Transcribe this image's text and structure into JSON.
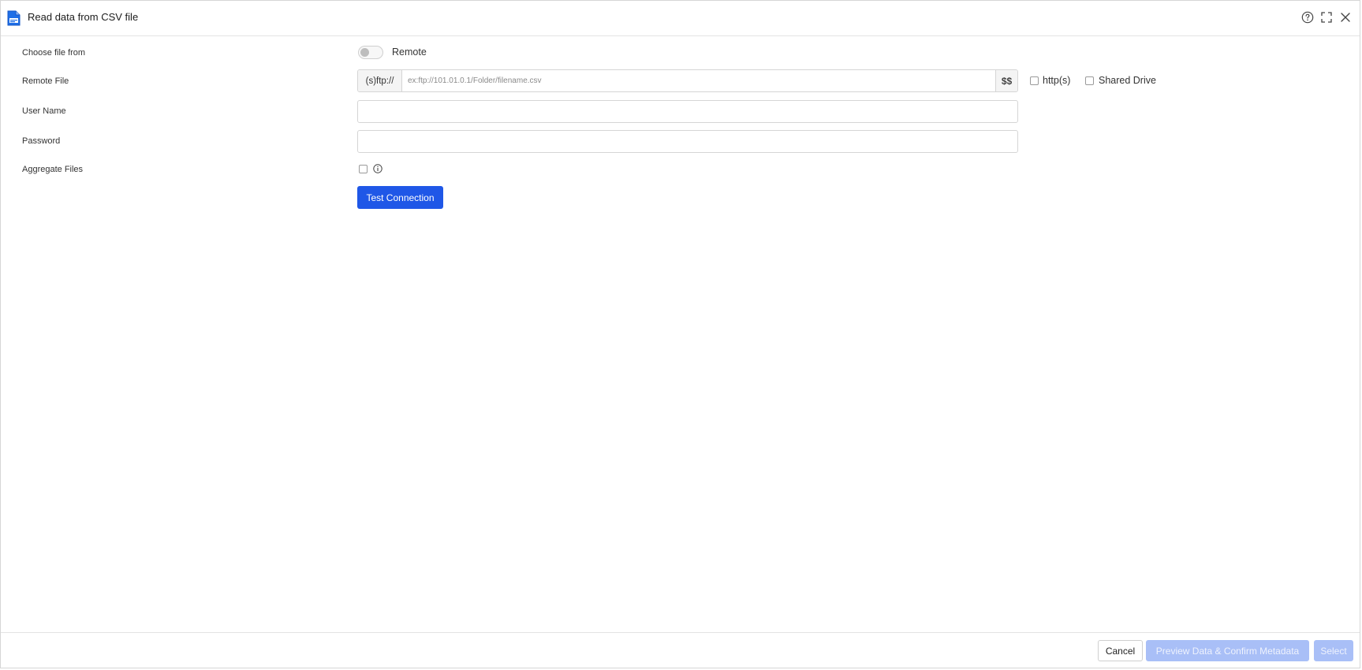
{
  "dialog": {
    "title": "Read data from CSV file",
    "icons": {
      "app": "csv-file-icon",
      "help": "help-icon",
      "maximize": "fullscreen-icon",
      "close": "close-icon"
    }
  },
  "form": {
    "choose_file_from": {
      "label": "Choose file from",
      "toggle_label": "Remote",
      "toggle_on": false
    },
    "remote_file": {
      "label": "Remote File",
      "prefix": "(s)ftp://",
      "value": "",
      "placeholder": "ex:ftp://101.01.0.1/Folder/filename.csv",
      "suffix": "$$",
      "options": {
        "http_label": "http(s)",
        "http_checked": false,
        "shared_drive_label": "Shared Drive",
        "shared_drive_checked": false
      }
    },
    "user_name": {
      "label": "User Name",
      "value": ""
    },
    "password": {
      "label": "Password",
      "value": ""
    },
    "aggregate_files": {
      "label": "Aggregate Files",
      "checked": false,
      "info_icon": "info-icon"
    },
    "test_connection_label": "Test Connection"
  },
  "footer": {
    "cancel_label": "Cancel",
    "preview_label": "Preview Data & Confirm Metadata",
    "select_label": "Select"
  },
  "colors": {
    "primary": "#1f57e7",
    "primary_disabled": "#a9bff7",
    "border": "#d5d5d5"
  }
}
